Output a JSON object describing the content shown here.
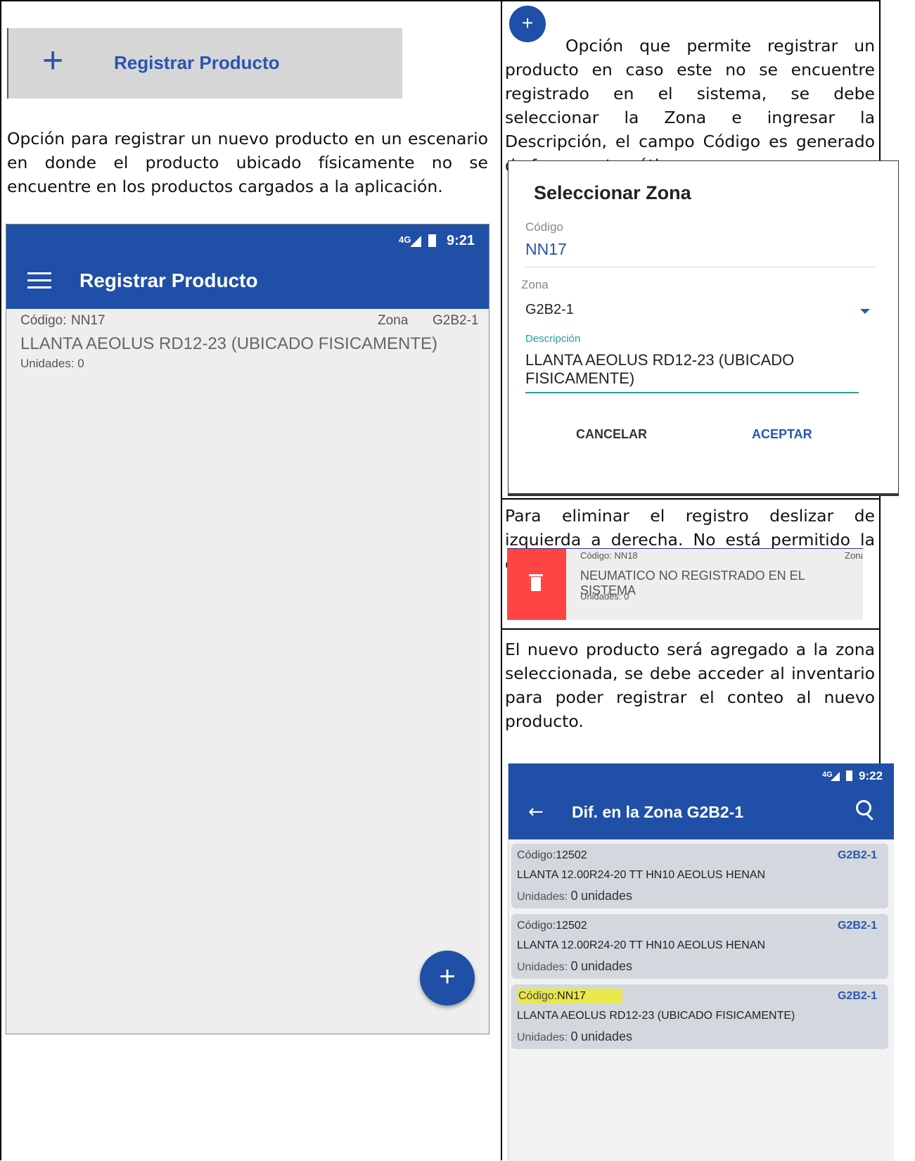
{
  "left": {
    "menu_item": {
      "icon": "plus-icon",
      "label": "Registrar Producto"
    },
    "description": "Opción para registrar un nuevo producto en un escenario en donde el producto ubicado físicamente no se encuentre en los productos cargados a la aplicación.",
    "phone": {
      "status_time": "9:21",
      "status_network": "4G",
      "title": "Registrar Producto",
      "item": {
        "code_label": "Código:",
        "code": "NN17",
        "zone_label": "Zona",
        "zone": "G2B2-1",
        "description": "LLANTA AEOLUS RD12-23 (UBICADO FISICAMENTE)",
        "units": "Unidades: 0"
      },
      "fab_icon": "plus-icon"
    }
  },
  "right": {
    "cell1": {
      "text": "Opción que permite registrar un producto en caso este no se encuentre registrado en el sistema, se debe seleccionar la Zona e ingresar la  Descripción, el campo Código es generado de forma automática",
      "dialog": {
        "title": "Seleccionar Zona",
        "code_label": "Código",
        "code_value": "NN17",
        "zone_label": "Zona",
        "zone_value": "G2B2-1",
        "desc_label": "Descripción",
        "desc_line1": "LLANTA AEOLUS RD12-23 (UBICADO",
        "desc_line2": "FISICAMENTE)",
        "cancel": "CANCELAR",
        "accept": "ACEPTAR"
      }
    },
    "cell2": {
      "text": "Para eliminar el registro deslizar de izquierda a derecha. No está permitido la edición.",
      "item": {
        "code": "Código: NN18",
        "zone": "Zona",
        "description": "NEUMATICO NO REGISTRADO EN EL SISTEMA",
        "units": "Unidades: 0"
      }
    },
    "cell3": {
      "text": "El nuevo producto será agregado a la zona seleccionada, se debe acceder al inventario para poder registrar el conteo al nuevo producto.",
      "phone": {
        "status_time": "9:22",
        "status_network": "4G",
        "title": "Dif. en la Zona G2B2-1",
        "items": [
          {
            "code_label": "Código:",
            "code": "12502",
            "zone": "G2B2-1",
            "description": "LLANTA 12.00R24-20 TT HN10 AEOLUS HENAN",
            "units_label": "Unidades:",
            "units_value": "0",
            "units_suffix": "unidades"
          },
          {
            "code_label": "Código:",
            "code": "12502",
            "zone": "G2B2-1",
            "description": "LLANTA 12.00R24-20 TT HN10 AEOLUS HENAN",
            "units_label": "Unidades:",
            "units_value": "0",
            "units_suffix": "unidades"
          },
          {
            "code_label": "Código:",
            "code": "NN17",
            "zone": "G2B2-1",
            "description": "LLANTA AEOLUS RD12-23 (UBICADO FISICAMENTE)",
            "units_label": "Unidades:",
            "units_value": "0",
            "units_suffix": "unidades"
          }
        ]
      }
    }
  },
  "colors": {
    "primary": "#1f4fa6",
    "delete": "#ff4444",
    "highlight": "#e8e84a"
  }
}
